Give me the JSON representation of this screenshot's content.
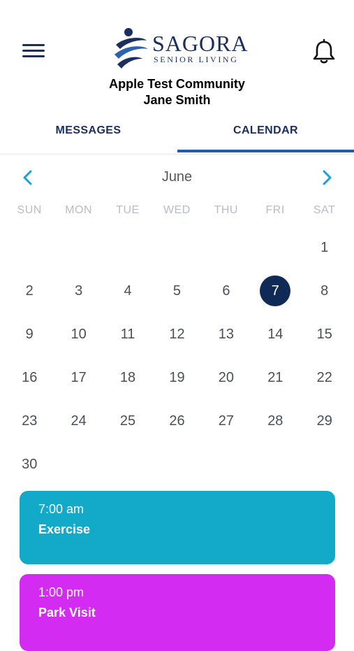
{
  "header": {
    "brand": "SAGORA",
    "brand_tagline": "SENIOR LIVING",
    "community": "Apple Test Community",
    "user": "Jane Smith"
  },
  "icons": {
    "menu": "hamburger-menu-icon",
    "notifications": "bell-icon",
    "prev": "chevron-left-icon",
    "next": "chevron-right-icon"
  },
  "tabs": [
    {
      "label": "MESSAGES",
      "active": false
    },
    {
      "label": "CALENDAR",
      "active": true
    }
  ],
  "calendar": {
    "month": "June",
    "weekdays": [
      "SUN",
      "MON",
      "TUE",
      "WED",
      "THU",
      "FRI",
      "SAT"
    ],
    "first_weekday_index": 6,
    "days_in_month": 30,
    "selected_day": 7
  },
  "events": [
    {
      "time": "7:00 am",
      "title": "Exercise",
      "color": "#12aac8"
    },
    {
      "time": "1:00 pm",
      "title": "Park Visit",
      "color": "#d42bf2"
    }
  ],
  "colors": {
    "brand_navy": "#1b2f5e",
    "accent_blue": "#1f5ea8",
    "arrow_cyan": "#17a3d9",
    "selected_day": "#0f2a57"
  }
}
